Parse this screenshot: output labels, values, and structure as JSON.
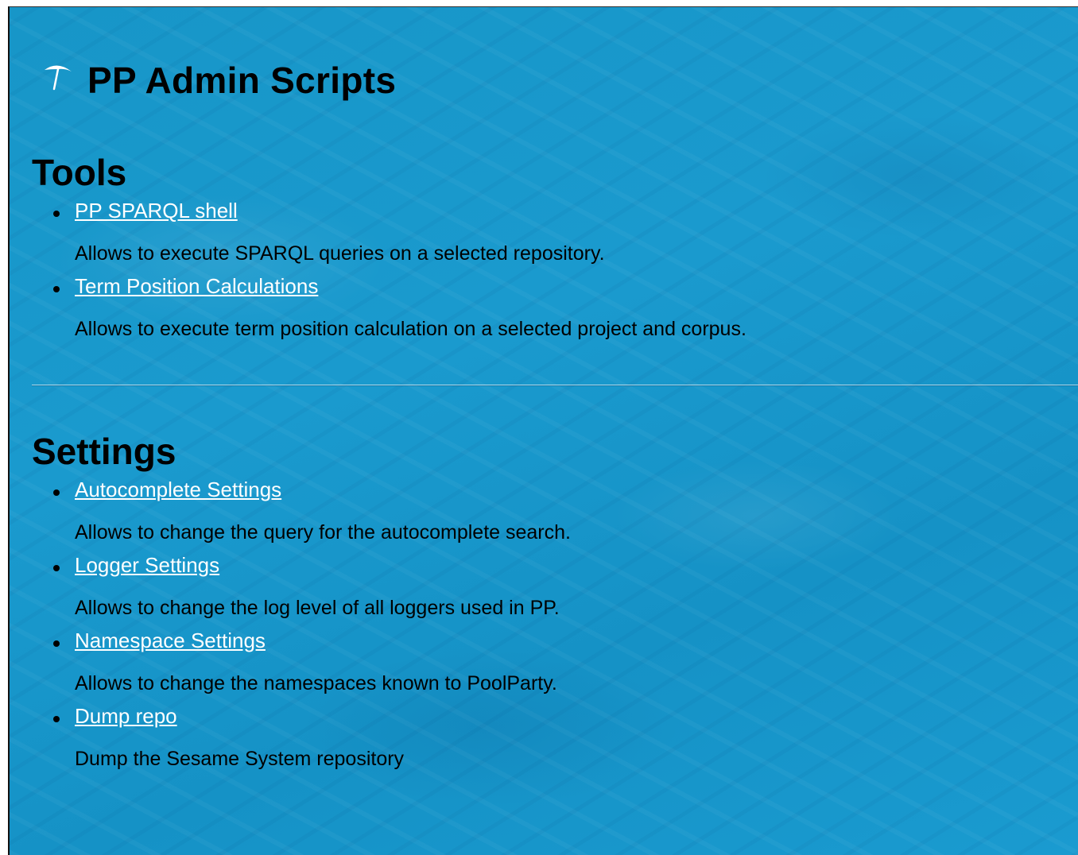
{
  "page": {
    "title": "PP Admin Scripts",
    "logo_icon": "umbrella-icon",
    "background": "#1a9ace"
  },
  "tools": {
    "heading": "Tools",
    "items": [
      {
        "label": "PP SPARQL shell",
        "description": "Allows to execute SPARQL queries on a selected repository."
      },
      {
        "label": "Term Position Calculations",
        "description": "Allows to execute term position calculation on a selected project and corpus."
      }
    ]
  },
  "settings": {
    "heading": "Settings",
    "items": [
      {
        "label": "Autocomplete Settings",
        "description": "Allows to change the query for the autocomplete search."
      },
      {
        "label": "Logger Settings",
        "description": "Allows to change the log level of all loggers used in PP."
      },
      {
        "label": "Namespace Settings",
        "description": "Allows to change the namespaces known to PoolParty."
      },
      {
        "label": "Dump repo",
        "description": "Dump the Sesame System repository"
      }
    ]
  }
}
